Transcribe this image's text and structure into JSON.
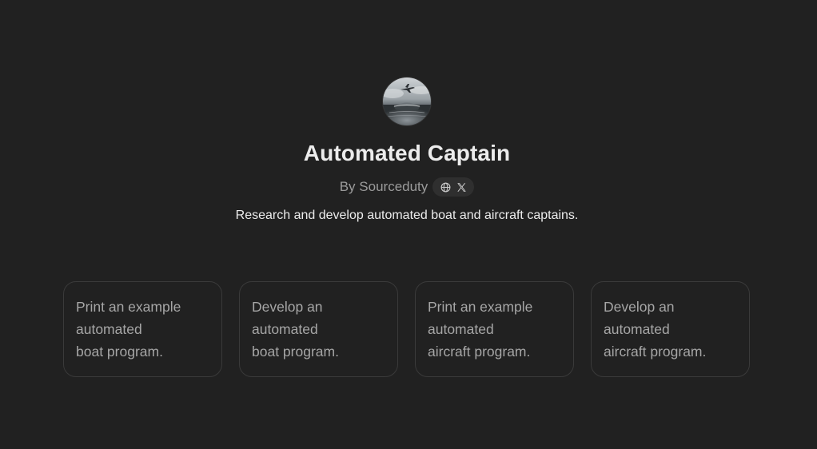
{
  "gpt": {
    "avatar_icon": "boat-aircraft-avatar",
    "name": "Automated Captain",
    "byline": "By Sourceduty",
    "social_icons": [
      "globe-icon",
      "x-logo-icon"
    ],
    "description": "Research and develop automated boat and aircraft captains."
  },
  "conversation_starters": [
    {
      "lines": [
        "Print an example",
        "automated",
        "boat program."
      ]
    },
    {
      "lines": [
        "Develop an",
        "automated",
        "boat program."
      ]
    },
    {
      "lines": [
        "Print an example",
        "automated",
        "aircraft program."
      ]
    },
    {
      "lines": [
        "Develop an",
        "automated",
        "aircraft program."
      ]
    }
  ],
  "colors": {
    "background": "#212121",
    "title_text": "#ececec",
    "muted_text": "#9b9b9b",
    "card_border": "#3a3a3a",
    "card_text": "#a6a6a6",
    "pill_background": "#2f2f2f"
  }
}
